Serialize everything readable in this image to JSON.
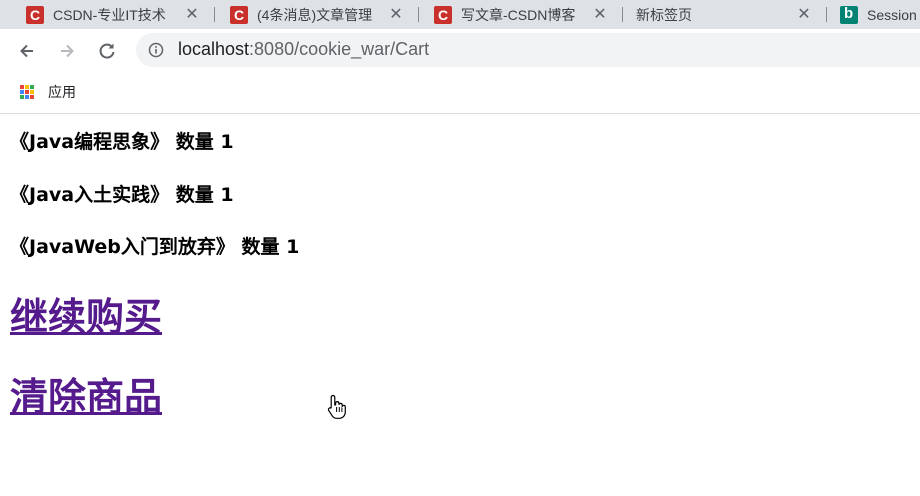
{
  "tabs": [
    {
      "title": "CSDN-专业IT技术",
      "favicon": "csdn-icon"
    },
    {
      "title": "(4条消息)文章管理",
      "favicon": "csdn-icon"
    },
    {
      "title": "写文章-CSDN博客",
      "favicon": "csdn-icon"
    },
    {
      "title": "新标签页",
      "favicon": ""
    },
    {
      "title": "Session",
      "favicon": "bing-icon"
    }
  ],
  "address_bar": {
    "host": "localhost",
    "rest": ":8080/cookie_war/Cart"
  },
  "bookmarks": {
    "apps_label": "应用"
  },
  "cart": {
    "items": [
      "《Java编程思象》 数量 1",
      "《Java入土实践》 数量 1",
      "《JavaWeb入门到放弃》 数量 1"
    ],
    "continue_label": "继续购买",
    "clear_label": "清除商品"
  },
  "colors": {
    "link_visited": "#551a8b",
    "csdn_red": "#c9302c",
    "tabstrip": "#dee1e6"
  }
}
